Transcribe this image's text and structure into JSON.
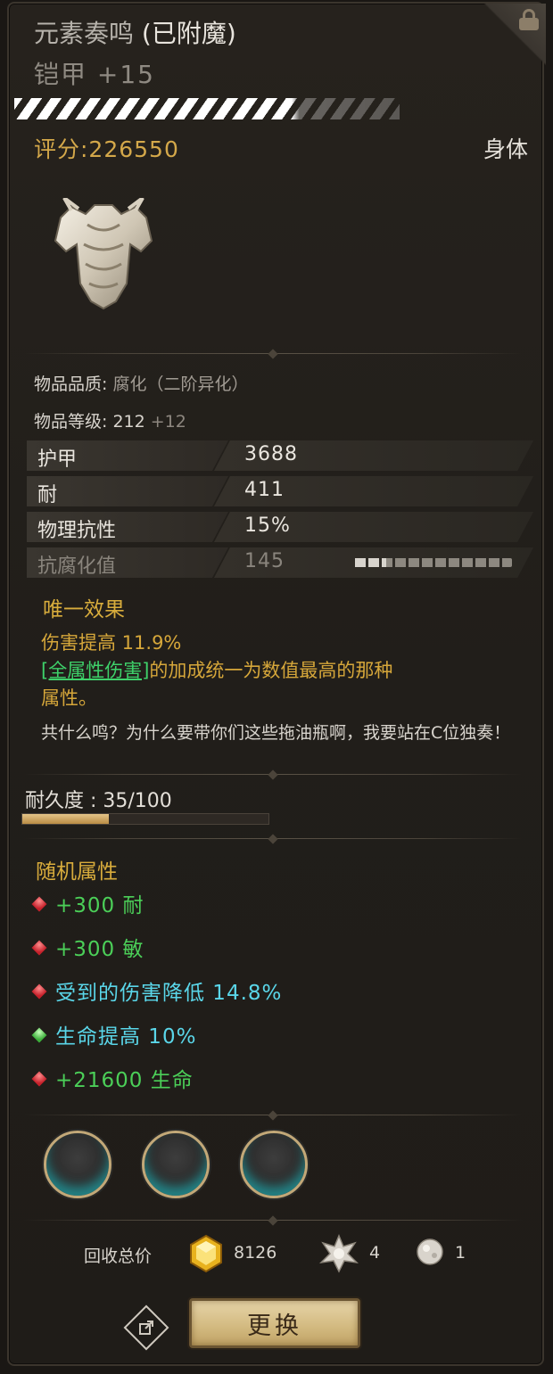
{
  "header": {
    "item_name": "元素奏鸣",
    "enchant_suffix": " (已附魔)",
    "item_type": "铠甲 +15"
  },
  "score": {
    "label": "评分:226550"
  },
  "slot": "身体",
  "info": {
    "quality_label": "物品品质: ",
    "quality_value": "腐化（二阶异化）",
    "level_label": "物品等级: ",
    "level_value": "212",
    "level_bonus": " +12"
  },
  "stats": [
    {
      "name": "护甲",
      "value": "3688"
    },
    {
      "name": "耐",
      "value": "411"
    },
    {
      "name": "物理抗性",
      "value": "15%"
    },
    {
      "name": "抗腐化值",
      "value": "145"
    }
  ],
  "corruption_level": 0.2,
  "unique": {
    "heading": "唯一效果",
    "line1": "伤害提高 11.9%",
    "link_text": "[全属性伤害]",
    "line2_rest": "的加成统一为数值最高的那种",
    "line3": "属性。"
  },
  "lore": "共什么鸣？为什么要带你们这些拖油瓶啊，我要站在C位独奏！",
  "durability": {
    "label": "耐久度 : 35/100",
    "current": 35,
    "max": 100
  },
  "random": {
    "heading": "随机属性",
    "lines": [
      {
        "gem": "red",
        "text": "+300 耐"
      },
      {
        "gem": "red",
        "text": "+300 敏"
      },
      {
        "gem": "red",
        "text": "受到的伤害降低 14.8%"
      },
      {
        "gem": "green",
        "text": "生命提高 10%"
      },
      {
        "gem": "red",
        "text": "+21600 生命"
      }
    ]
  },
  "recycle": {
    "label": "回收总价",
    "gold": "8126",
    "shard_a": "4",
    "shard_b": "1"
  },
  "buttons": {
    "swap": "更换"
  }
}
